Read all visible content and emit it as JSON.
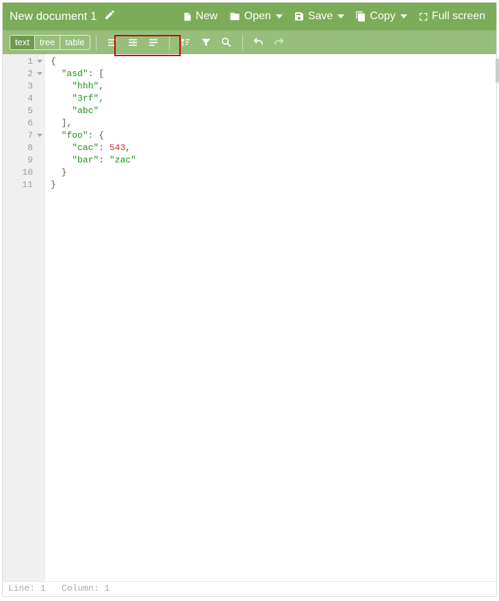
{
  "header": {
    "title": "New document 1",
    "new_label": "New",
    "open_label": "Open",
    "save_label": "Save",
    "copy_label": "Copy",
    "fullscreen_label": "Full screen"
  },
  "toolbar": {
    "viewmodes": {
      "text": "text",
      "tree": "tree",
      "table": "table",
      "active": "text"
    }
  },
  "editor": {
    "lines": [
      {
        "n": 1,
        "fold": true,
        "tokens": [
          [
            "p",
            "{"
          ]
        ]
      },
      {
        "n": 2,
        "fold": true,
        "tokens": [
          [
            "sp",
            "  "
          ],
          [
            "k",
            "\"asd\""
          ],
          [
            "p",
            ": ["
          ]
        ]
      },
      {
        "n": 3,
        "fold": false,
        "tokens": [
          [
            "sp",
            "    "
          ],
          [
            "k",
            "\"hhh\""
          ],
          [
            "p",
            ","
          ]
        ]
      },
      {
        "n": 4,
        "fold": false,
        "tokens": [
          [
            "sp",
            "    "
          ],
          [
            "k",
            "\"3rf\""
          ],
          [
            "p",
            ","
          ]
        ]
      },
      {
        "n": 5,
        "fold": false,
        "tokens": [
          [
            "sp",
            "    "
          ],
          [
            "k",
            "\"abc\""
          ]
        ]
      },
      {
        "n": 6,
        "fold": false,
        "tokens": [
          [
            "sp",
            "  "
          ],
          [
            "p",
            "],"
          ]
        ]
      },
      {
        "n": 7,
        "fold": true,
        "tokens": [
          [
            "sp",
            "  "
          ],
          [
            "k",
            "\"foo\""
          ],
          [
            "p",
            ": {"
          ]
        ]
      },
      {
        "n": 8,
        "fold": false,
        "tokens": [
          [
            "sp",
            "    "
          ],
          [
            "k",
            "\"cac\""
          ],
          [
            "p",
            ": "
          ],
          [
            "n",
            "543"
          ],
          [
            "p",
            ","
          ]
        ]
      },
      {
        "n": 9,
        "fold": false,
        "tokens": [
          [
            "sp",
            "    "
          ],
          [
            "k",
            "\"bar\""
          ],
          [
            "p",
            ": "
          ],
          [
            "k",
            "\"zac\""
          ]
        ]
      },
      {
        "n": 10,
        "fold": false,
        "tokens": [
          [
            "sp",
            "  "
          ],
          [
            "p",
            "}"
          ]
        ]
      },
      {
        "n": 11,
        "fold": false,
        "tokens": [
          [
            "p",
            "}"
          ]
        ]
      }
    ]
  },
  "status": {
    "line_label": "Line:",
    "line": "1",
    "col_label": "Column:",
    "col": "1"
  }
}
